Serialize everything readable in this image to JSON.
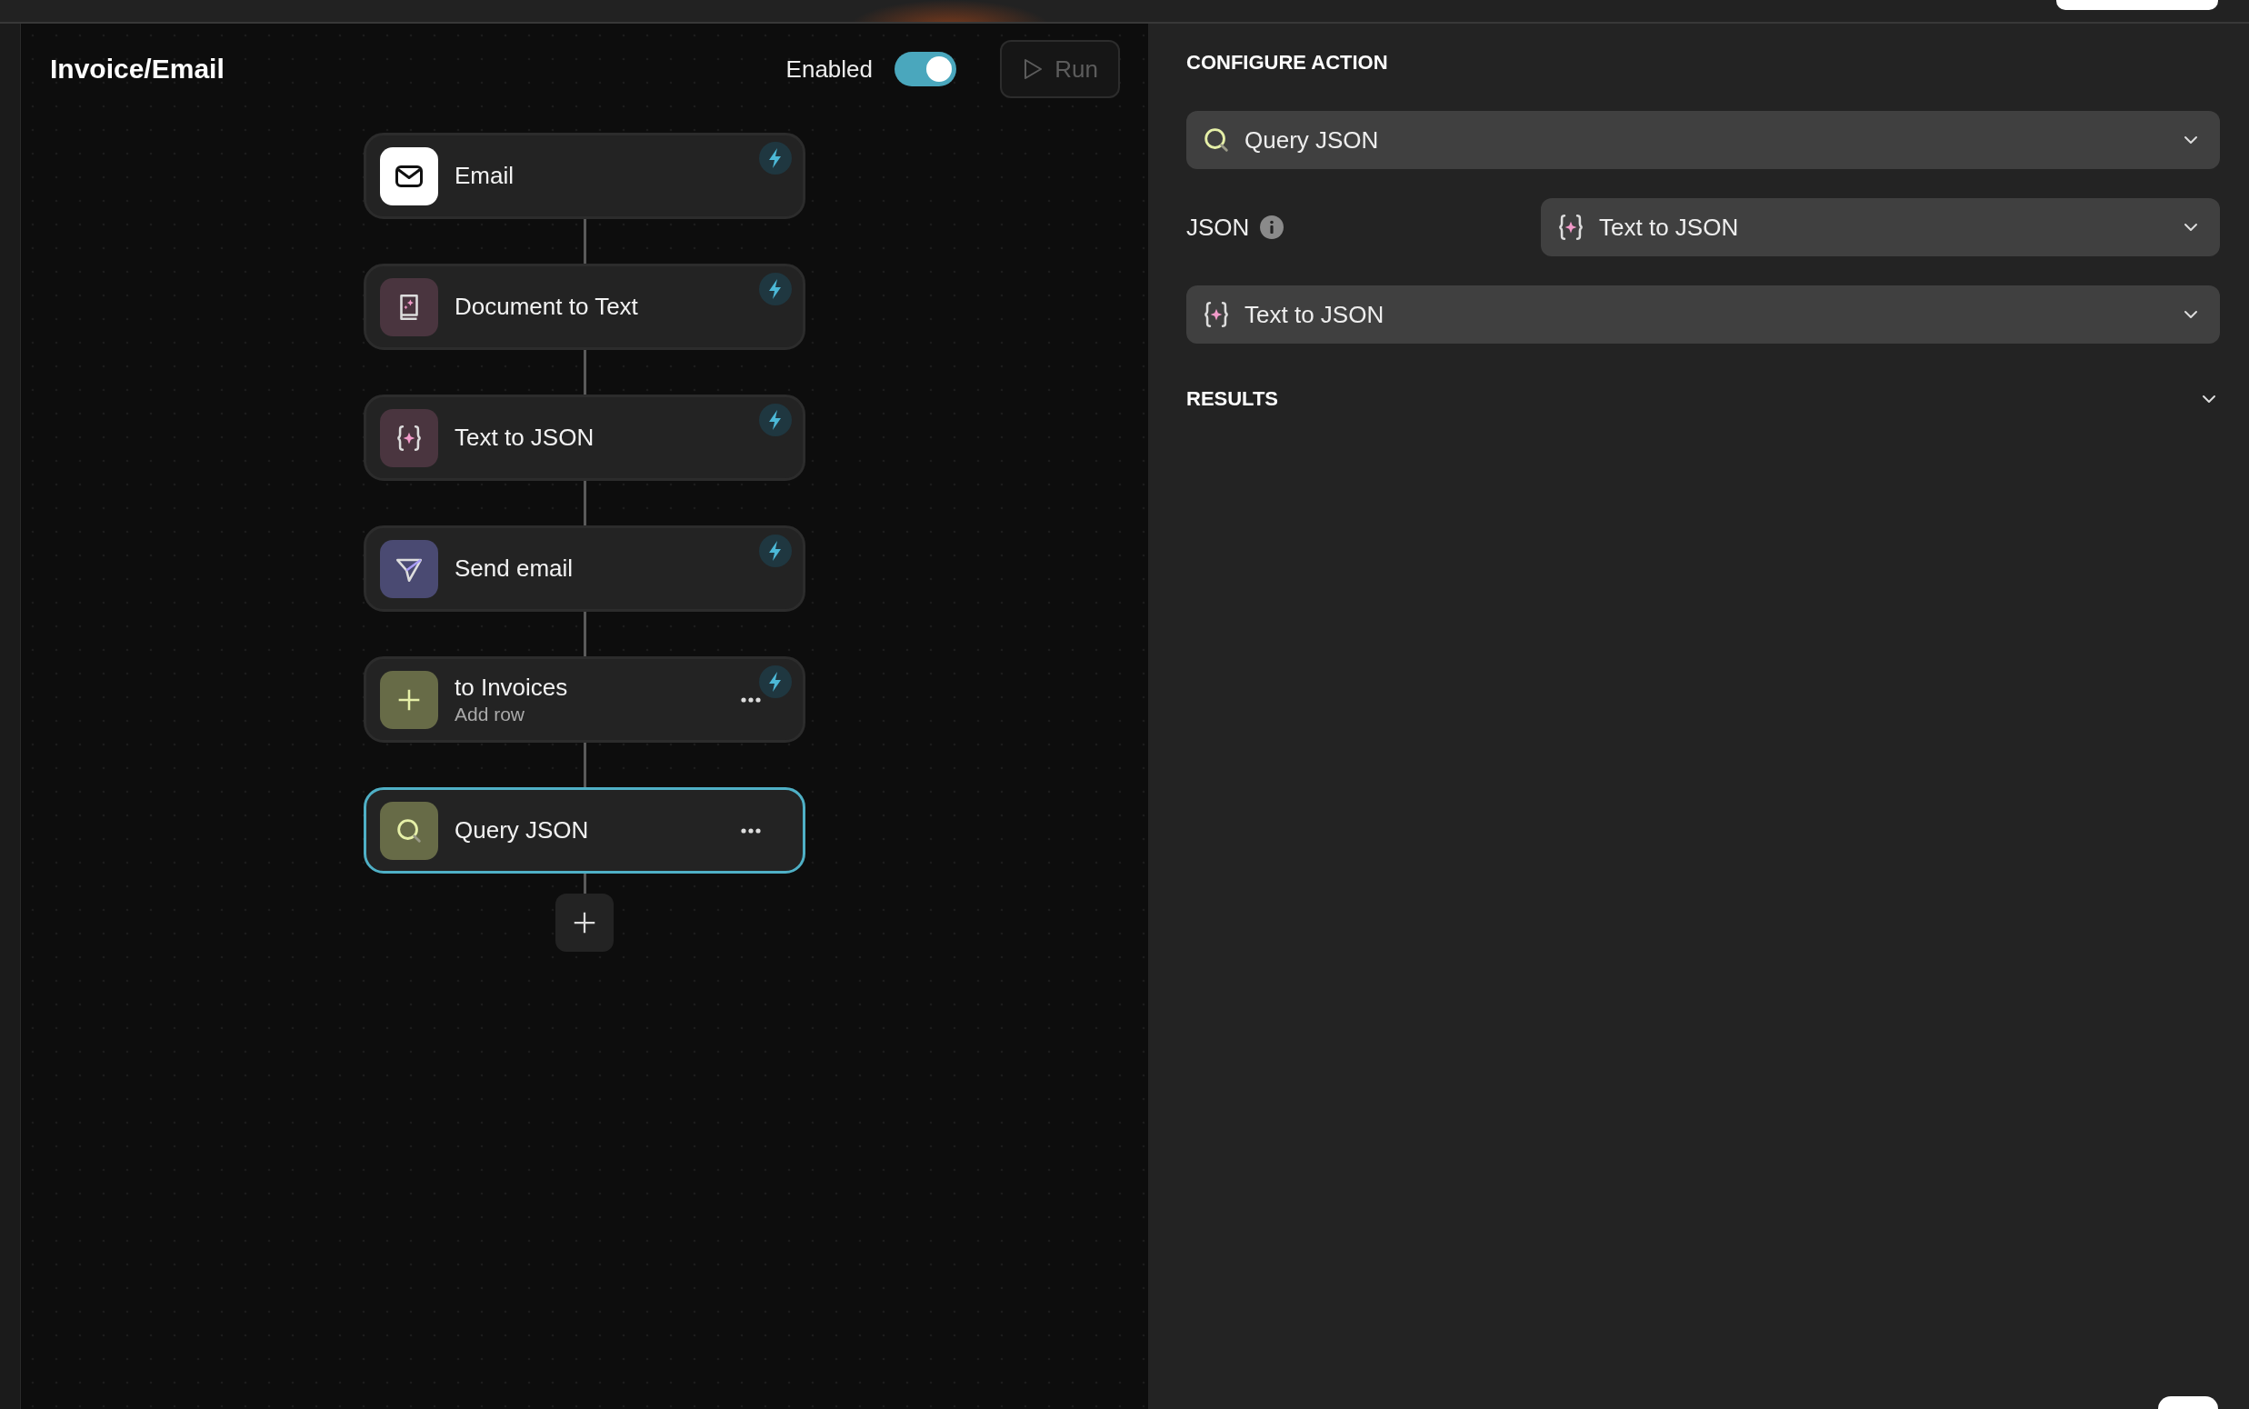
{
  "workflow": {
    "title": "Invoice/Email",
    "enabled_label": "Enabled",
    "enabled": true,
    "run": {
      "label": "Run",
      "disabled": true
    }
  },
  "steps": [
    {
      "kind": "mail",
      "label": "Email",
      "bolt": true,
      "menu": false,
      "selected": false
    },
    {
      "kind": "document",
      "label": "Document to Text",
      "bolt": true,
      "menu": false,
      "selected": false
    },
    {
      "kind": "braces",
      "label": "Text to JSON",
      "bolt": true,
      "menu": false,
      "selected": false
    },
    {
      "kind": "send",
      "label": "Send email",
      "bolt": true,
      "menu": false,
      "selected": false
    },
    {
      "kind": "add",
      "label": "to Invoices",
      "sublabel": "Add row",
      "bolt": true,
      "menu": true,
      "selected": false
    },
    {
      "kind": "search",
      "label": "Query JSON",
      "bolt": false,
      "menu": true,
      "selected": true
    }
  ],
  "panel": {
    "heading": "CONFIGURE ACTION",
    "action": {
      "kind": "search",
      "value": "Query JSON"
    },
    "fields": [
      {
        "label": "JSON",
        "info": true,
        "kind": "braces",
        "value": "Text to JSON"
      }
    ],
    "source": {
      "kind": "braces",
      "value": "Text to JSON"
    },
    "results": {
      "title": "RESULTS",
      "expanded": false
    }
  }
}
